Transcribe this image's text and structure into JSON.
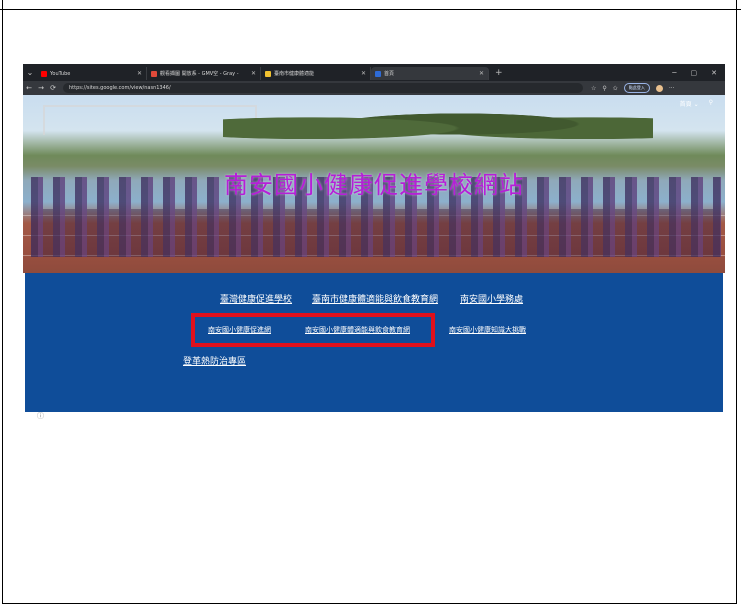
{
  "browser": {
    "tabs": [
      {
        "title": "YouTube",
        "favicon_color": "#ff0000",
        "active": false
      },
      {
        "title": "觀看擷圖 開放系 - GMV空 - Gray - ",
        "favicon_color": "#e04a3a",
        "active": false
      },
      {
        "title": "臺南市健康體適能",
        "favicon_color": "#f2c230",
        "active": false
      },
      {
        "title": "首頁",
        "favicon_color": "#2e6bd6",
        "active": true
      }
    ],
    "new_tab_label": "+",
    "url": "https://sites.google.com/view/nasn1346/",
    "profile_label": "點此登入"
  },
  "site": {
    "title": "南安國小健康促進學校網站",
    "menu_label": "首頁",
    "links_row1": [
      "臺灣健康促進學校",
      "臺南市健康體適能與飲食教育網",
      "南安國小學務處"
    ],
    "links_row2": [
      "南安國小健康促進網",
      "南安國小健康體適能與飲食教育網",
      "南安國小健康知識大挑戰"
    ],
    "links_row3": [
      "登革熱防治專區"
    ]
  },
  "colors": {
    "page_bg": "#0f4d99",
    "title_color": "#b61fd8",
    "highlight_box": "#e0101c"
  }
}
